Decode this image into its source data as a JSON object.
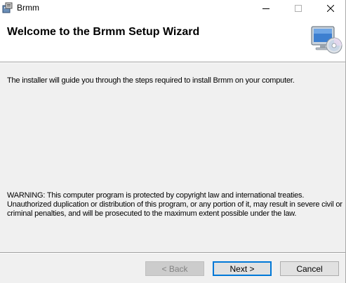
{
  "window": {
    "title": "Brmm",
    "icon": "installer-box-icon",
    "controls": {
      "minimize": "minimize-icon",
      "maximize": "maximize-icon",
      "close": "close-icon"
    }
  },
  "banner": {
    "title": "Welcome to the Brmm Setup Wizard",
    "icon": "computer-cd-icon"
  },
  "body": {
    "intro": "The installer will guide you through the steps required to install Brmm on your computer.",
    "warning": "WARNING: This computer program is protected by copyright law and international treaties. Unauthorized duplication or distribution of this program, or any portion of it, may result in severe civil or criminal penalties, and will be prosecuted to the maximum extent possible under the law."
  },
  "footer": {
    "back_label": "< Back",
    "back_enabled": false,
    "next_label": "Next >",
    "cancel_label": "Cancel"
  },
  "colors": {
    "accent": "#0078d7",
    "background": "#f0f0f0",
    "banner": "#ffffff"
  }
}
